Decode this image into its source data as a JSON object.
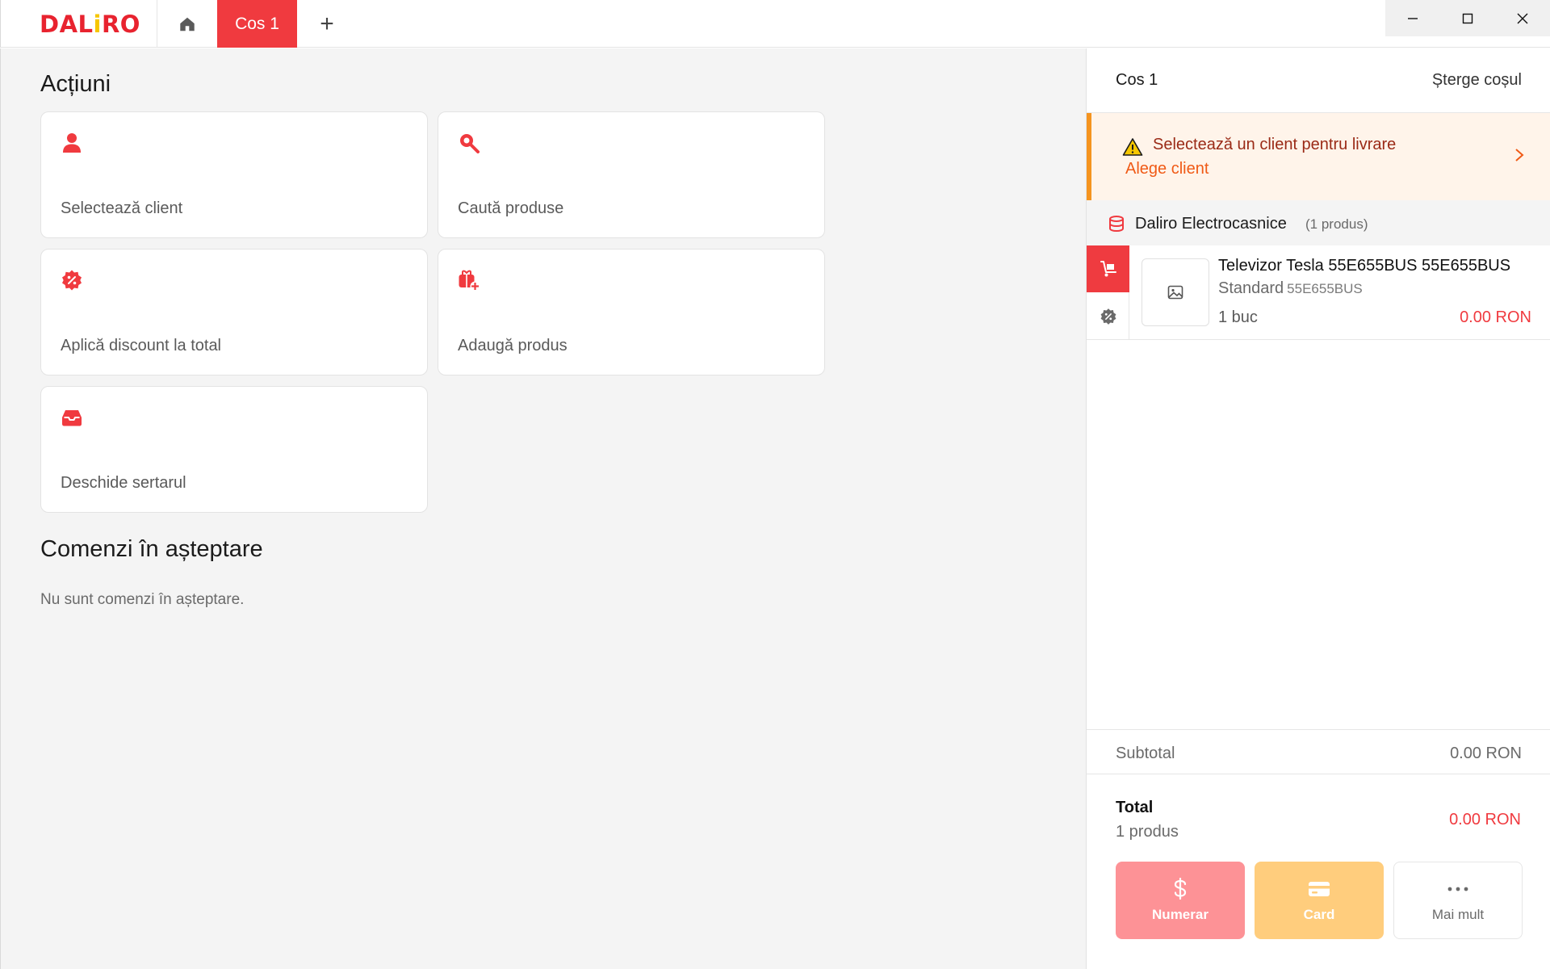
{
  "app": {
    "logo_text_a": "DAL",
    "logo_text_i": "i",
    "logo_text_b": "RO",
    "brand_color": "#e8232f",
    "accent_color": "#f03a3f"
  },
  "tabs": {
    "active_label": "Cos 1",
    "add_label": "+"
  },
  "main": {
    "actions_title": "Acțiuni",
    "actions": [
      {
        "label": "Selectează client",
        "icon": "user-icon"
      },
      {
        "label": "Caută produse",
        "icon": "search-icon"
      },
      {
        "label": "Aplică discount la total",
        "icon": "discount-icon"
      },
      {
        "label": "Adaugă produs",
        "icon": "add-product-icon"
      },
      {
        "label": "Deschide sertarul",
        "icon": "drawer-icon"
      }
    ],
    "pending_title": "Comenzi în așteptare",
    "pending_empty": "Nu sunt comenzi în așteptare."
  },
  "cart": {
    "title": "Cos 1",
    "clear_label": "Șterge coșul",
    "alert": {
      "title": "Selectează un client pentru livrare",
      "link": "Alege client"
    },
    "store": {
      "name": "Daliro Electrocasnice",
      "count": "(1 produs)"
    },
    "items": [
      {
        "name": "Televizor Tesla 55E655BUS 55E655BUS",
        "variant": "Standard",
        "sku": "55E655BUS",
        "qty": "1 buc",
        "price": "0.00 RON"
      }
    ],
    "subtotal_label": "Subtotal",
    "subtotal_value": "0.00 RON",
    "total_label": "Total",
    "total_count": "1 produs",
    "total_value": "0.00 RON",
    "pay": {
      "cash_label": "Numerar",
      "card_label": "Card",
      "more_label": "Mai mult"
    }
  }
}
